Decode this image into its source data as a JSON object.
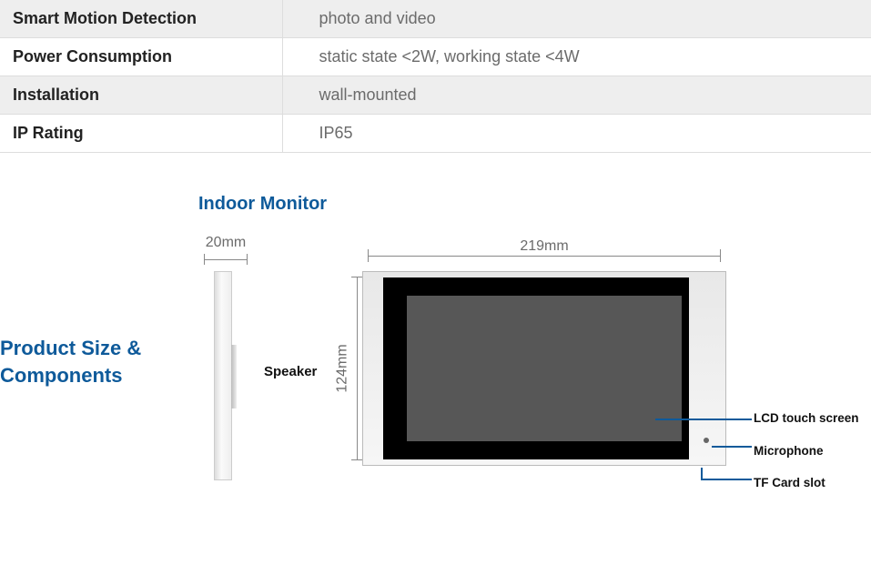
{
  "specs": [
    {
      "label": "Smart Motion Detection",
      "value": "photo and video"
    },
    {
      "label": "Power Consumption",
      "value": "static state <2W, working state <4W"
    },
    {
      "label": "Installation",
      "value": "wall-mounted"
    },
    {
      "label": "IP Rating",
      "value": "IP65"
    }
  ],
  "section_title_line1": "Product Size &",
  "section_title_line2": "Components",
  "diagram": {
    "title": "Indoor Monitor",
    "depth": "20mm",
    "width": "219mm",
    "height": "124mm",
    "labels": {
      "speaker": "Speaker",
      "lcd": "LCD touch screen",
      "mic": "Microphone",
      "tf": "TF Card slot"
    }
  }
}
